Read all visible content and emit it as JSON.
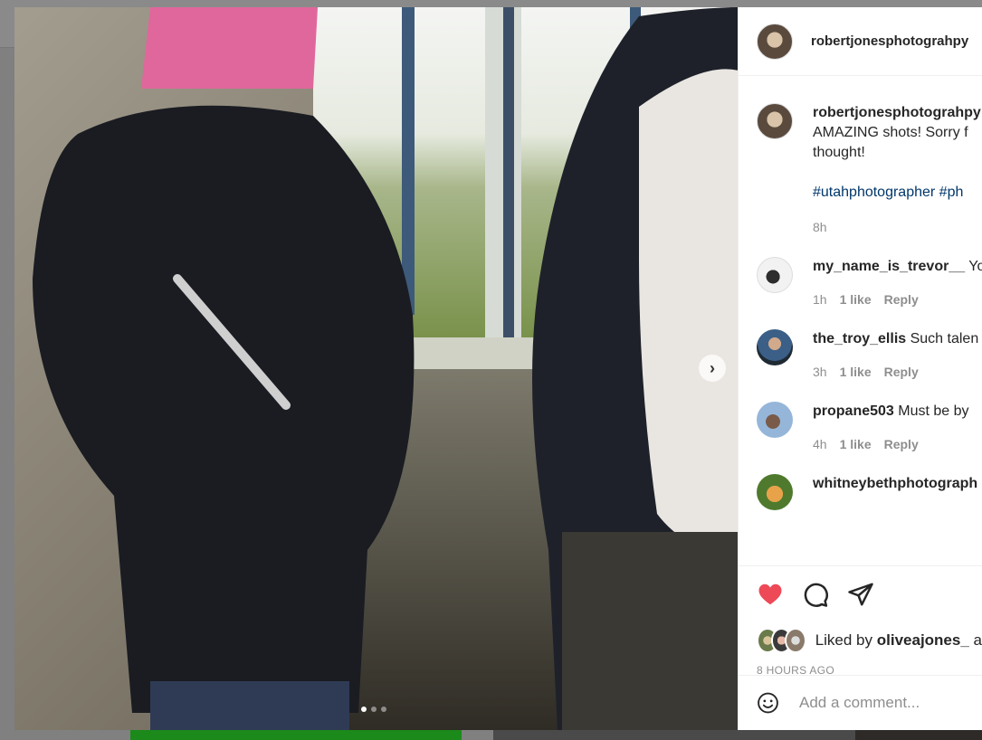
{
  "post": {
    "owner": "robertjonesphotograhpy",
    "caption_user": "robertjonesphotograhpy",
    "caption_text": "AMAZING shots! Sorry f",
    "caption_text2": "thought!",
    "caption_tags": "#utahphotographer #ph",
    "caption_time": "8h",
    "carousel": {
      "total": 3,
      "active": 1
    }
  },
  "comments": [
    {
      "user": "my_name_is_trevor__",
      "text": "Yo",
      "time": "1h",
      "likes": "1 like",
      "reply": "Reply"
    },
    {
      "user": "the_troy_ellis",
      "text": "Such talen",
      "time": "3h",
      "likes": "1 like",
      "reply": "Reply"
    },
    {
      "user": "propane503",
      "text": "Must be by",
      "time": "4h",
      "likes": "1 like",
      "reply": "Reply"
    },
    {
      "user": "whitneybethphotograph",
      "text": "",
      "time": "",
      "likes": "",
      "reply": ""
    }
  ],
  "actions": {
    "liked_prefix": "Liked by",
    "liked_user": "oliveajones_",
    "liked_suffix": "a",
    "timestamp": "8 HOURS AGO"
  },
  "add_comment": {
    "placeholder": "Add a comment..."
  },
  "colors": {
    "like": "#ed4956",
    "link": "#00376b",
    "muted": "#8e8e8e"
  }
}
